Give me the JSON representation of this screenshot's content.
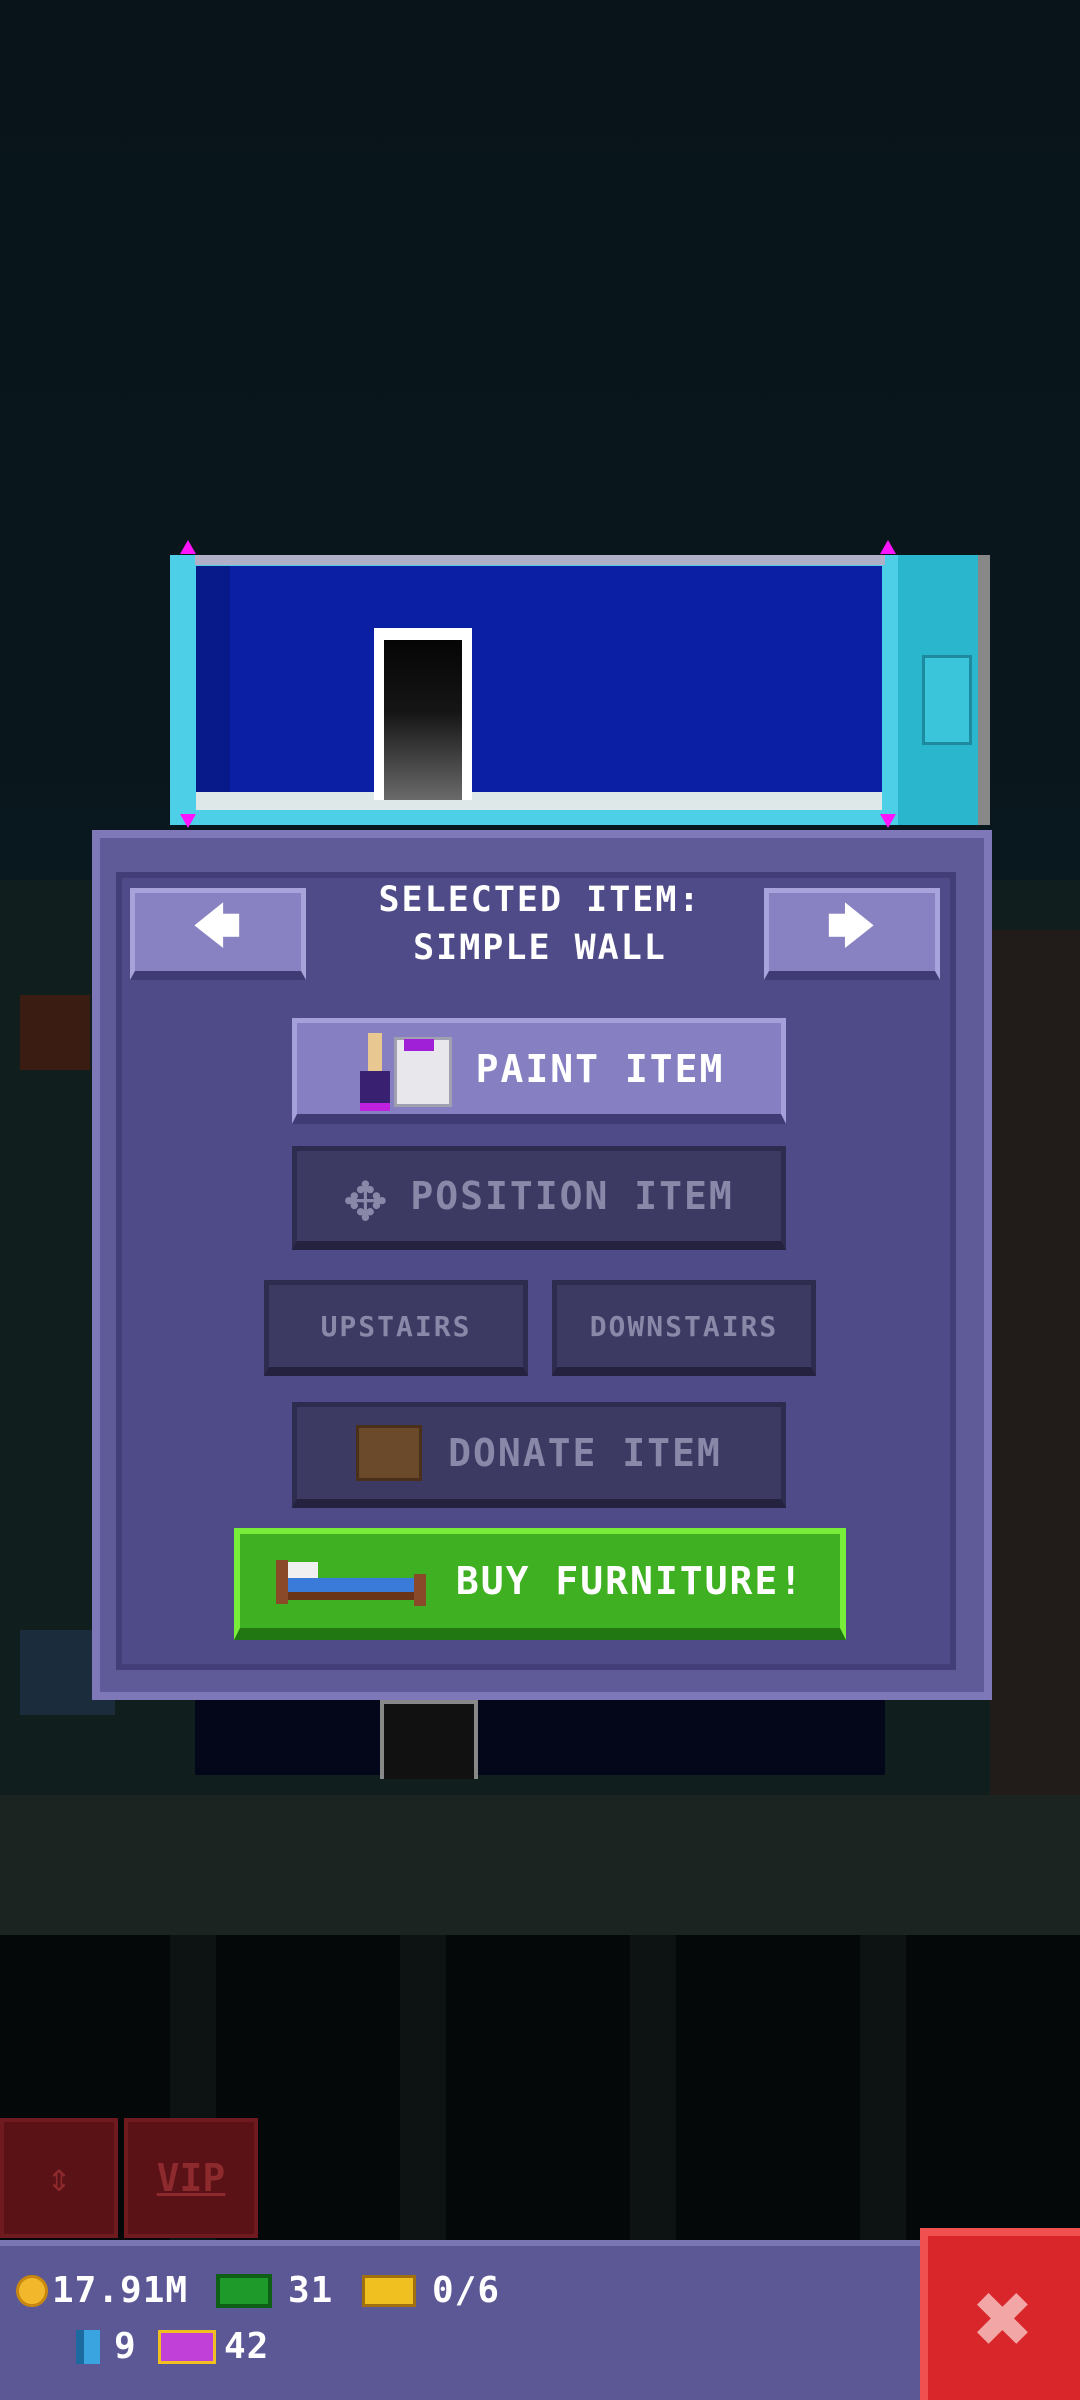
{
  "dialog": {
    "selected_label": "SELECTED ITEM:",
    "selected_item": "SIMPLE WALL",
    "prev_arrow": "🡄",
    "next_arrow": "🡆",
    "paint_label": "PAINT ITEM",
    "position_label": "POSITION ITEM",
    "upstairs_label": "UPSTAIRS",
    "downstairs_label": "DOWNSTAIRS",
    "donate_label": "DONATE ITEM",
    "buy_label": "BUY FURNITURE!"
  },
  "controls": {
    "elevator_arrows": "⇕",
    "vip_label": "VIP"
  },
  "stats": {
    "coins": "17.91M",
    "bux": "31",
    "tickets": "0/6",
    "bits": "9",
    "vip_cards": "42"
  },
  "close_symbol": "✖",
  "colors": {
    "wall": "#0a1fa3",
    "dialog": "#5f5a98",
    "buy_button": "#3fb022",
    "close_button": "#d8262a"
  }
}
